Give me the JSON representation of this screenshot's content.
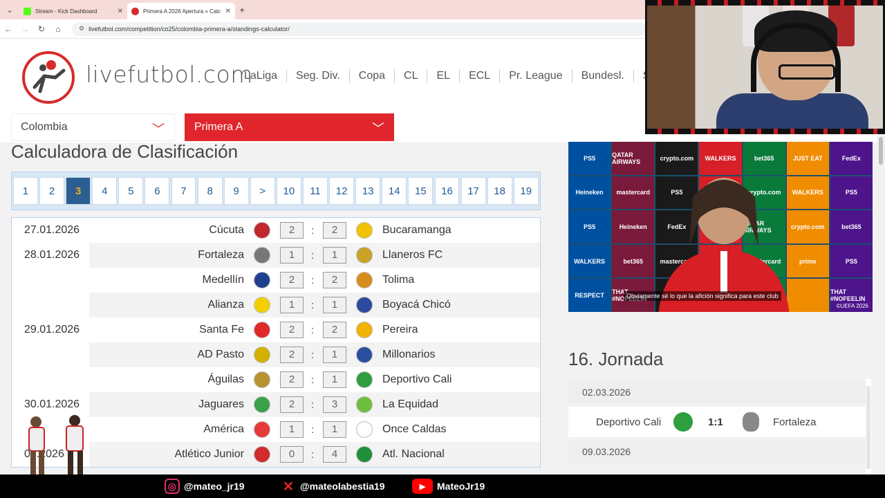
{
  "browser": {
    "tabs": [
      {
        "label": "Stream - Kick Dashboard",
        "favicon_color": "#53fc18"
      },
      {
        "label": "Primera A 2026 Apertura » Calc",
        "favicon_color": "#d62b2b"
      }
    ],
    "url": "livefutbol.com/competition/co25/colombia-primera-a/standings-calculator/"
  },
  "site": {
    "logo_text": "livefutbol.com",
    "nav": [
      "LaLiga",
      "Seg. Div.",
      "Copa",
      "CL",
      "EL",
      "ECL",
      "Pr. League",
      "Bundesl.",
      "Se"
    ],
    "country_select": "Colombia",
    "league_select": "Primera A",
    "accent": "#e0262c"
  },
  "main": {
    "title": "Calculadora de Clasificación",
    "rounds": [
      "1",
      "2",
      "3",
      "4",
      "5",
      "6",
      "7",
      "8",
      "9",
      ">",
      "10",
      "11",
      "12",
      "13",
      "14",
      "15",
      "16",
      "17",
      "18",
      "19"
    ],
    "active_round": "3",
    "matches": [
      {
        "date": "27.01.2026",
        "home": "Cúcuta",
        "hs": "2",
        "as": "2",
        "away": "Bucaramanga",
        "hc": "#c0282d",
        "ac": "#f2c200"
      },
      {
        "date": "28.01.2026",
        "home": "Fortaleza",
        "hs": "1",
        "as": "1",
        "away": "Llaneros FC",
        "hc": "#777777",
        "ac": "#c9a227"
      },
      {
        "date": "",
        "home": "Medellín",
        "hs": "2",
        "as": "2",
        "away": "Tolima",
        "hc": "#1f3f8f",
        "ac": "#d98c1e"
      },
      {
        "date": "",
        "home": "Alianza",
        "hs": "1",
        "as": "1",
        "away": "Boyacá Chicó",
        "hc": "#f2d000",
        "ac": "#2e4a9e"
      },
      {
        "date": "29.01.2026",
        "home": "Santa Fe",
        "hs": "2",
        "as": "2",
        "away": "Pereira",
        "hc": "#e02828",
        "ac": "#f2b200"
      },
      {
        "date": "",
        "home": "AD Pasto",
        "hs": "2",
        "as": "1",
        "away": "Millonarios",
        "hc": "#d4b000",
        "ac": "#2a4fa0"
      },
      {
        "date": "",
        "home": "Águilas",
        "hs": "2",
        "as": "1",
        "away": "Deportivo Cali",
        "hc": "#b8922e",
        "ac": "#2e9e3f"
      },
      {
        "date": "30.01.2026",
        "home": "Jaguares",
        "hs": "2",
        "as": "3",
        "away": "La Equidad",
        "hc": "#3aa14a",
        "ac": "#6cbf3c"
      },
      {
        "date": "",
        "home": "América",
        "hs": "1",
        "as": "1",
        "away": "Once Caldas",
        "hc": "#e63a3a",
        "ac": "#ffffff"
      },
      {
        "date": "03.2026",
        "home": "Atlético Junior",
        "hs": "0",
        "as": "4",
        "away": "Atl. Nacional",
        "hc": "#d12b2b",
        "ac": "#1f8f3a"
      }
    ]
  },
  "sidebar": {
    "video_subtitle": "Obviamente sé lo que la afición significa para este club",
    "video_copyright": "©UEFA 2026",
    "board_ads": [
      "PS5",
      "QATAR AIRWAYS",
      "crypto.com",
      "WALKERS",
      "bet365",
      "JUST EAT",
      "FedEx",
      "Heineken",
      "mastercard",
      "PS5",
      "FedEx",
      "crypto.com",
      "WALKERS",
      "PS5",
      "PS5",
      "Heineken",
      "FedEx",
      "bet365",
      "QATAR AIRWAYS",
      "crypto.com",
      "bet365",
      "WALKERS",
      "bet365",
      "mastercard",
      "PS5",
      "mastercard",
      "prime",
      "PS5",
      "RESPECT",
      "THAT #NOFEELIN",
      "",
      "",
      "prime",
      "",
      "THAT #NOFEELIN"
    ],
    "jornada_title": "16. Jornada",
    "jornada_dates": [
      "02.03.2026",
      "09.03.2026"
    ],
    "jornada_match": {
      "home": "Deportivo Cali",
      "score": "1:1",
      "away": "Fortaleza"
    }
  },
  "social": [
    {
      "icon": "instagram-icon",
      "handle": "@mateo_jr19",
      "color": "#e1306c"
    },
    {
      "icon": "x-icon",
      "handle": "@mateolabestia19",
      "color": "#e02020"
    },
    {
      "icon": "youtube-icon",
      "handle": "MateoJr19",
      "color": "#ff0000"
    }
  ]
}
